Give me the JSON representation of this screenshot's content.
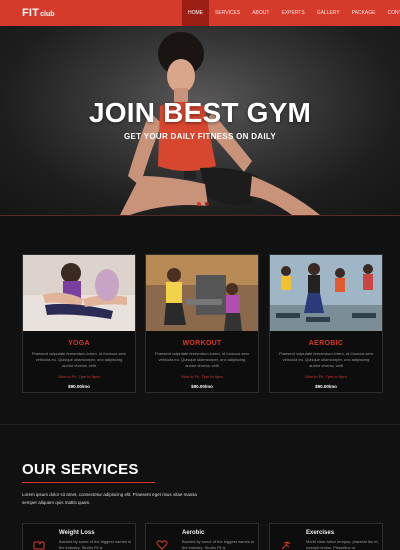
{
  "nav": {
    "logo_main": "FIT",
    "logo_sub": "club",
    "items": [
      {
        "label": "HOME",
        "active": true
      },
      {
        "label": "SERVICES",
        "active": false
      },
      {
        "label": "ABOUT",
        "active": false
      },
      {
        "label": "EXPERTS",
        "active": false
      },
      {
        "label": "GALLERY",
        "active": false
      },
      {
        "label": "PACKAGE",
        "active": false
      },
      {
        "label": "CONTACT",
        "active": false
      }
    ]
  },
  "hero": {
    "title": "JOIN BEST GYM",
    "subtitle": "GET YOUR DAILY FITNESS ON DAILY",
    "slides": 2,
    "active_slide": 1
  },
  "classes": [
    {
      "title": "YOGA",
      "description": "Praesent vulputate fermentum lorem, id rhoncus sem vehicula eu. Quisque ullamcorper, orci adipiscing auctor viverra, velit",
      "time": "Mon to Fri, 7pm to 9pm",
      "price": "$90.00/mo"
    },
    {
      "title": "WORKOUT",
      "description": "Praesent vulputate fermentum lorem, id rhoncus sem vehicula eu. Quisque ullamcorper, orci adipiscing auctor viverra, velit",
      "time": "Mon to Fri, 7pm to 9pm",
      "price": "$90.00/mo"
    },
    {
      "title": "AEROBIC",
      "description": "Praesent vulputate fermentum lorem, id rhoncus sem vehicula eu. Quisque ullamcorper, orci adipiscing auctor viverra, velit",
      "time": "Mon to Fri, 7pm to 9pm",
      "price": "$90.00/mo"
    }
  ],
  "services": {
    "title": "OUR SERVICES",
    "intro": "Lorem ipsum dolor sit amet, consectetur adipiscing elit. Praesent eget risus vitae massa semper aliquam quis mattis quam.",
    "items": [
      {
        "name": "Weight Loss",
        "description": "Backed by some of the biggest names in the industry. Studio Fit is",
        "icon": "scale-icon"
      },
      {
        "name": "Aerobic",
        "description": "Backed by some of the biggest names in the industry. Studio Fit is",
        "icon": "heart-icon"
      },
      {
        "name": "Exercises",
        "description": "Morbi vitae tortor tempus, placerat leo et, suscipit lectus. Phasellus ut",
        "icon": "running-icon"
      }
    ]
  },
  "colors": {
    "accent": "#d53a2a",
    "active_nav": "#9b1f14",
    "background": "#111111"
  }
}
